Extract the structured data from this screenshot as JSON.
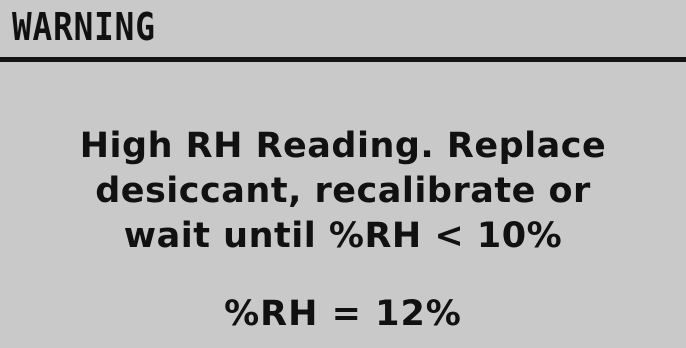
{
  "header": {
    "title": "WARNING"
  },
  "message": {
    "lines": [
      "High RH Reading. Replace",
      "desiccant, recalibrate or",
      "wait until %RH < 10%"
    ]
  },
  "reading": {
    "text": "%RH = 12%"
  },
  "colors": {
    "background": "#c9c9c9",
    "foreground": "#111111"
  }
}
